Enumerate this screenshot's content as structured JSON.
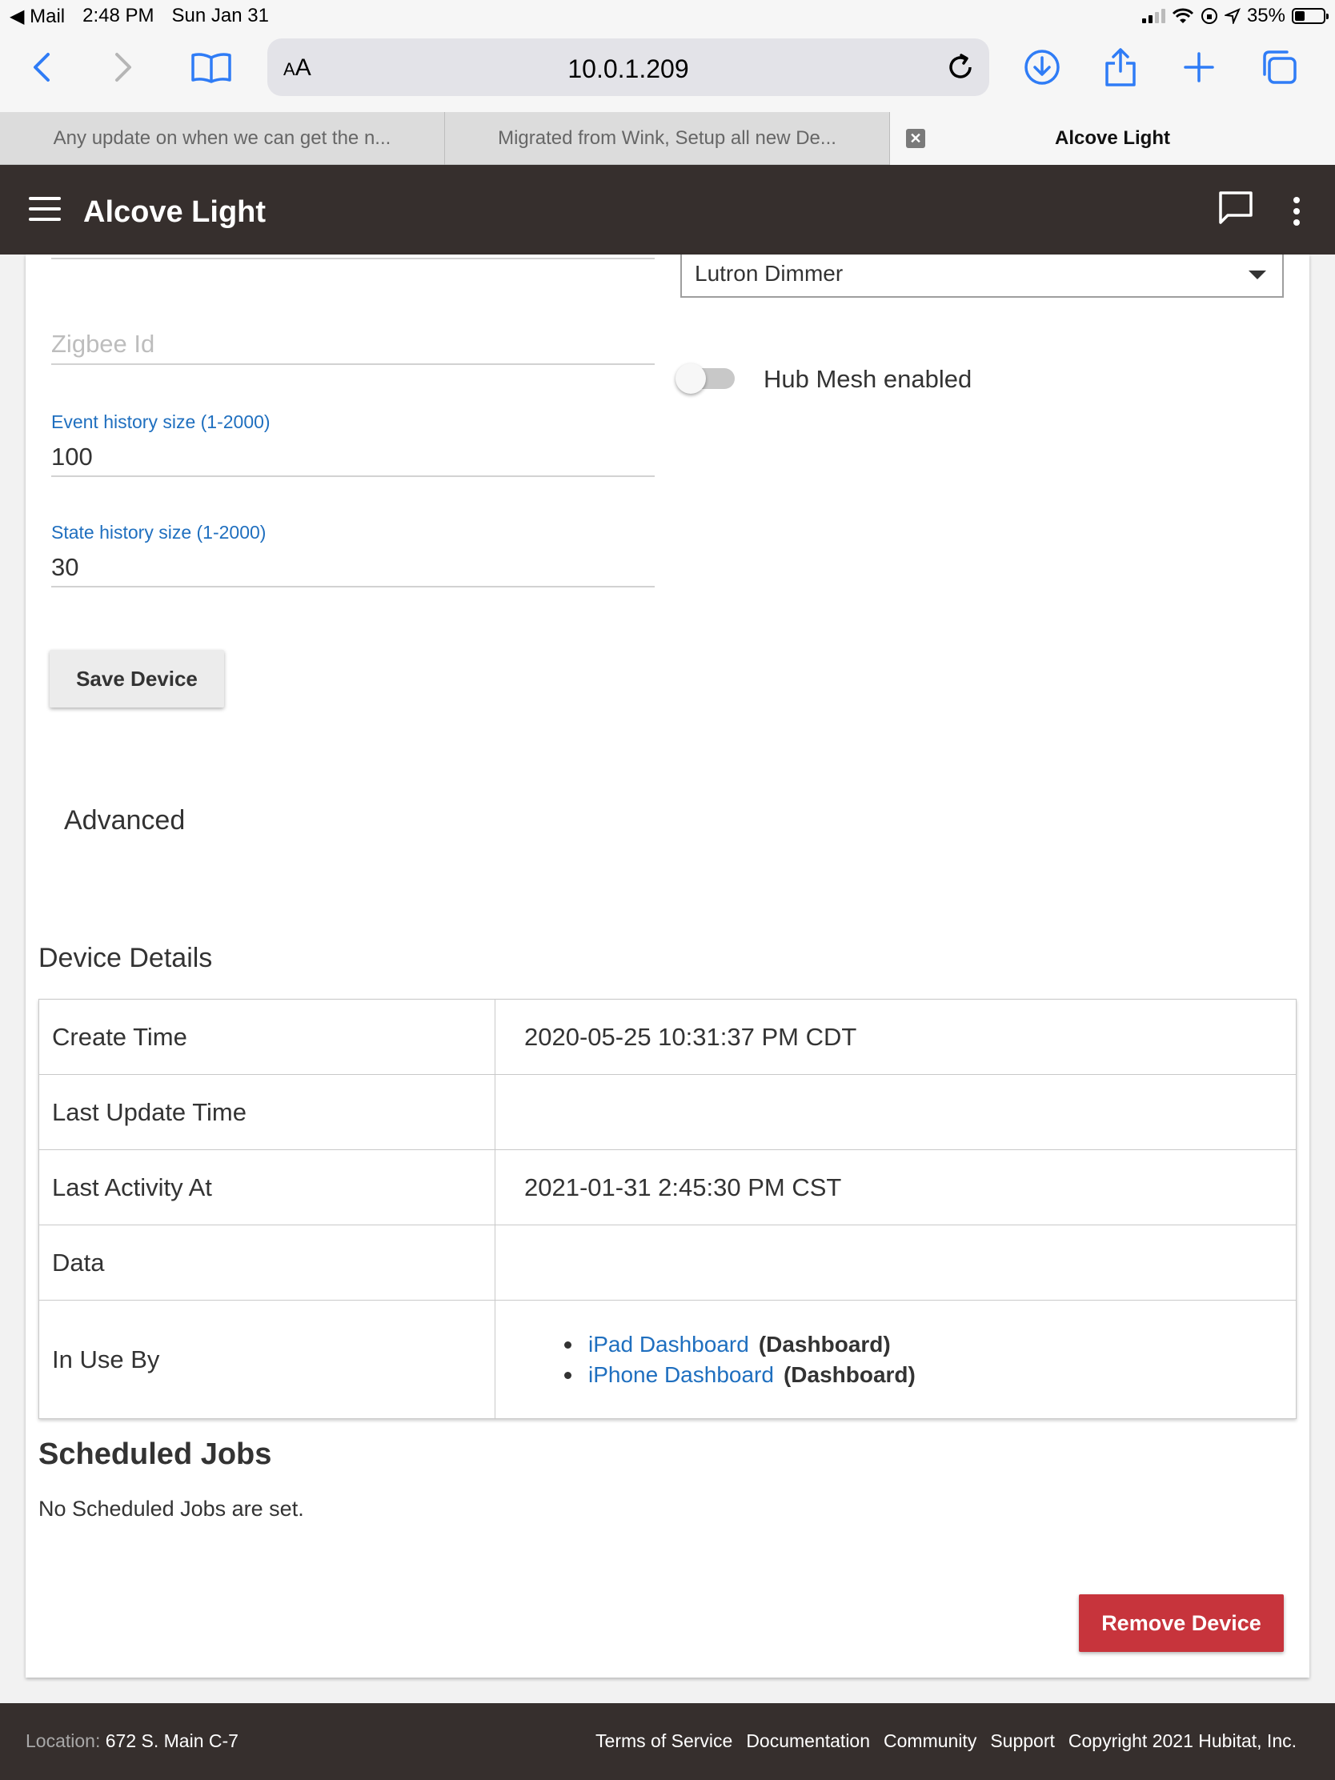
{
  "status_bar": {
    "back_app": "◀ Mail",
    "time": "2:48 PM",
    "date": "Sun Jan 31",
    "battery": "35%"
  },
  "browser": {
    "aa_label": "AA",
    "url": "10.0.1.209",
    "tabs": [
      {
        "label": "Any update on when we can get the n..."
      },
      {
        "label": "Migrated from Wink, Setup all new De..."
      },
      {
        "label": "Alcove Light"
      }
    ],
    "close_glyph": "✕"
  },
  "app": {
    "title": "Alcove Light"
  },
  "form": {
    "device_type_value": "Lutron Dimmer",
    "zigbee_placeholder": "Zigbee Id",
    "hub_mesh_label": "Hub Mesh enabled",
    "hub_mesh_enabled": false,
    "event_history_label": "Event history size (1-2000)",
    "event_history_value": "100",
    "state_history_label": "State history size (1-2000)",
    "state_history_value": "30",
    "save_button": "Save Device",
    "advanced_label": "Advanced"
  },
  "device_details": {
    "title": "Device Details",
    "rows": [
      {
        "key": "Create Time",
        "value": "2020-05-25 10:31:37 PM CDT"
      },
      {
        "key": "Last Update Time",
        "value": ""
      },
      {
        "key": "Last Activity At",
        "value": "2021-01-31 2:45:30 PM CST"
      },
      {
        "key": "Data",
        "value": ""
      },
      {
        "key": "In Use By",
        "value": ""
      }
    ],
    "in_use_by": [
      {
        "name": "iPad Dashboard",
        "type": "(Dashboard)"
      },
      {
        "name": "iPhone Dashboard",
        "type": "(Dashboard)"
      }
    ]
  },
  "scheduled_jobs": {
    "title": "Scheduled Jobs",
    "text": "No Scheduled Jobs are set."
  },
  "remove_button": "Remove Device",
  "footer": {
    "location_label": "Location:",
    "location_value": "672 S. Main C-7",
    "links": [
      "Terms of Service",
      "Documentation",
      "Community",
      "Support"
    ],
    "copyright": "Copyright 2021 Hubitat, Inc."
  },
  "colors": {
    "header_bg": "#362f2d",
    "link_blue": "#1f6fbf",
    "danger": "#c7343c",
    "safari_blue": "#2f7cf6"
  }
}
